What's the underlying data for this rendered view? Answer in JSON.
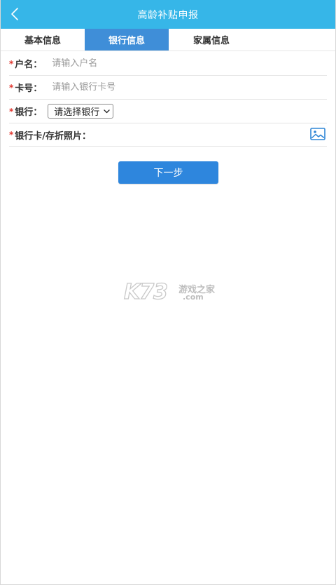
{
  "header": {
    "title": "高龄补贴申报",
    "back_icon": "chevron-left-icon"
  },
  "tabs": [
    {
      "label": "基本信息",
      "active": false
    },
    {
      "label": "银行信息",
      "active": true
    },
    {
      "label": "家属信息",
      "active": false
    }
  ],
  "form": {
    "required_mark": "*",
    "account_name": {
      "label": "户名：",
      "value": "",
      "placeholder": "请输入户名"
    },
    "card_number": {
      "label": "卡号：",
      "value": "",
      "placeholder": "请输入银行卡号"
    },
    "bank": {
      "label": "银行：",
      "selected": "请选择银行"
    },
    "photo": {
      "label": "银行卡/存折照片：",
      "icon": "image-upload-icon"
    }
  },
  "actions": {
    "next_label": "下一步"
  },
  "watermark": {
    "logo": "K73",
    "text": "游戏之家",
    "domain": ".com"
  },
  "colors": {
    "header_bg": "#36b6e8",
    "active_tab_bg": "#3f8ed8",
    "button_bg": "#2e86dd",
    "required_mark": "#e0342c",
    "icon_blue": "#2f86d6"
  }
}
